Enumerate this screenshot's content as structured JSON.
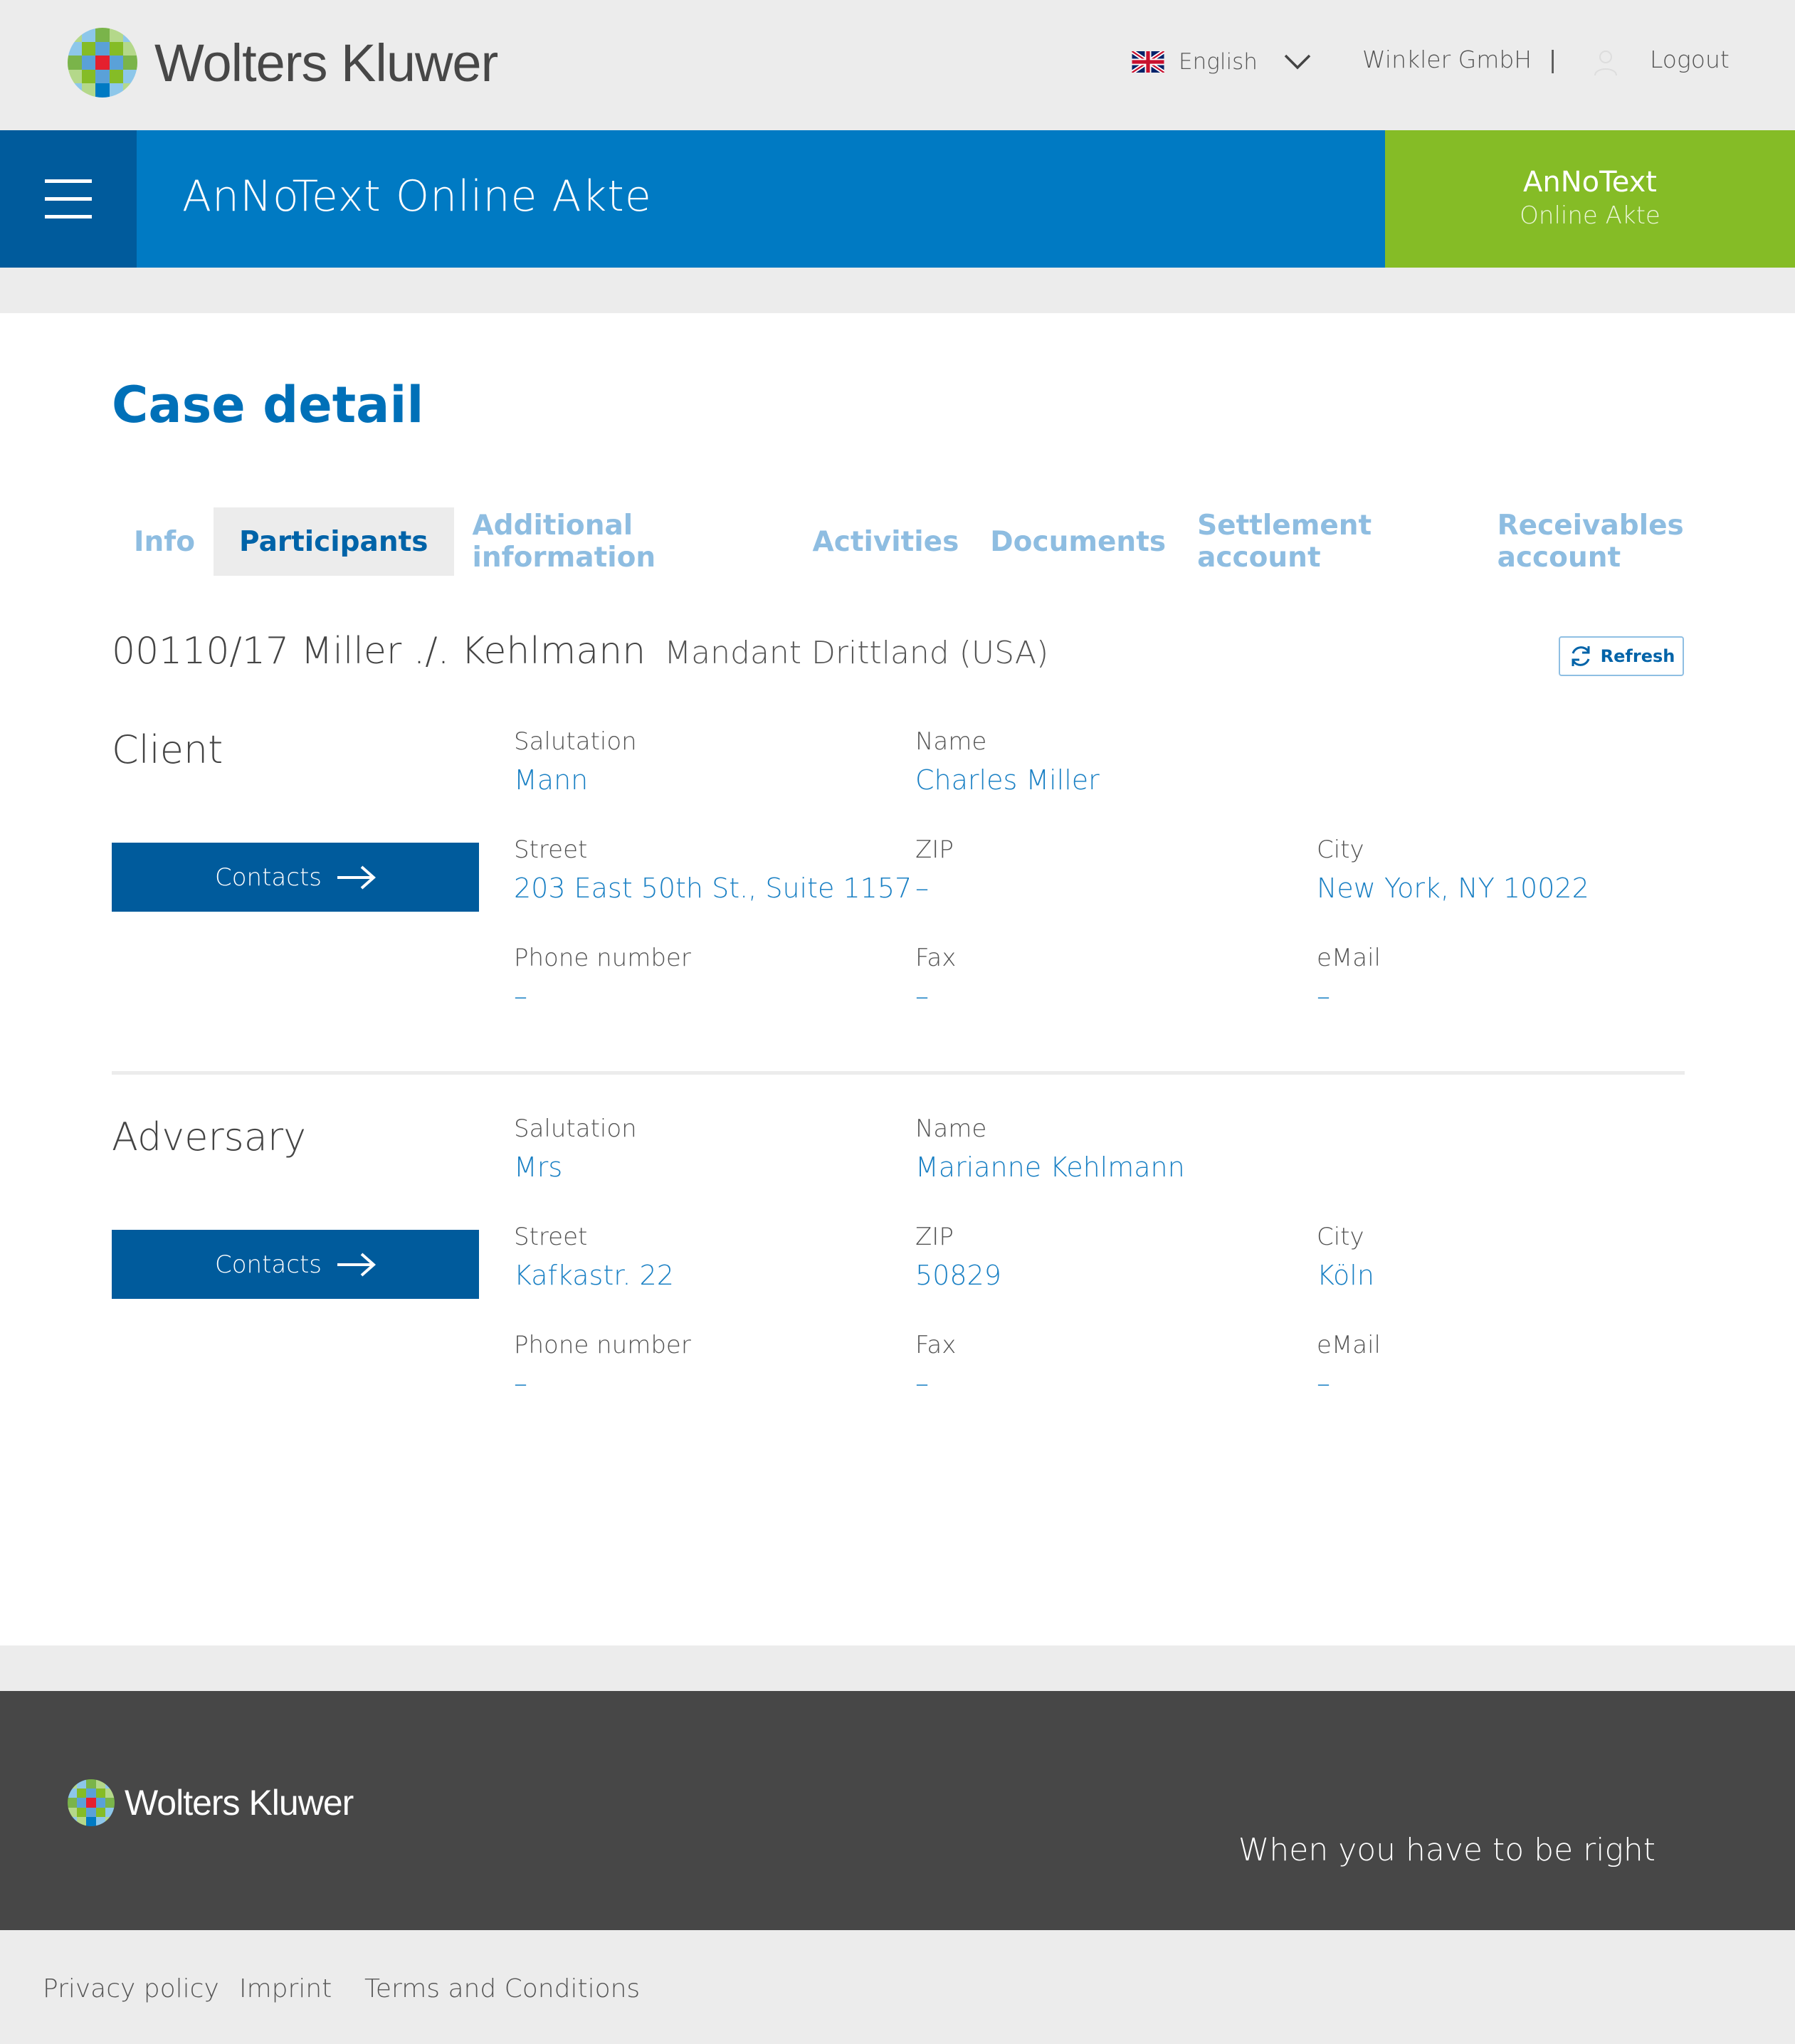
{
  "header": {
    "brand": "Wolters Kluwer",
    "language": "English",
    "company": "Winkler GmbH",
    "separator": "|",
    "logout": "Logout"
  },
  "appbar": {
    "title": "AnNoText Online Akte",
    "brand_line1": "AnNoText",
    "brand_line2": "Online Akte"
  },
  "page": {
    "title": "Case detail",
    "tabs": [
      {
        "label": "Info"
      },
      {
        "label": "Participants"
      },
      {
        "label": "Additional information"
      },
      {
        "label": "Activities"
      },
      {
        "label": "Documents"
      },
      {
        "label": "Settlement account"
      },
      {
        "label": "Receivables account"
      }
    ],
    "active_tab": "Participants",
    "case_id": "00110/17 Miller ./. Kehlmann",
    "case_subtitle": "Mandant Drittland (USA)",
    "refresh_label": "Refresh"
  },
  "client": {
    "title": "Client",
    "contacts_label": "Contacts",
    "salutation_label": "Salutation",
    "salutation": "Mann",
    "name_label": "Name",
    "name": "Charles Miller",
    "street_label": "Street",
    "street": "203 East 50th St., Suite 1157",
    "zip_label": "ZIP",
    "zip": "–",
    "city_label": "City",
    "city": "New York, NY 10022",
    "phone_label": "Phone number",
    "phone": "–",
    "fax_label": "Fax",
    "fax": "–",
    "email_label": "eMail",
    "email": "–"
  },
  "adversary": {
    "title": "Adversary",
    "contacts_label": "Contacts",
    "salutation_label": "Salutation",
    "salutation": "Mrs",
    "name_label": "Name",
    "name": "Marianne Kehlmann",
    "street_label": "Street",
    "street": "Kafkastr. 22",
    "zip_label": "ZIP",
    "zip": "50829",
    "city_label": "City",
    "city": "Köln",
    "phone_label": "Phone number",
    "phone": "–",
    "fax_label": "Fax",
    "fax": "–",
    "email_label": "eMail",
    "email": "–"
  },
  "footer": {
    "brand": "Wolters Kluwer",
    "tagline": "When you have to be right",
    "links": [
      "Privacy policy",
      "Imprint",
      "Terms and Conditions"
    ]
  },
  "colors": {
    "primary_blue": "#007ac3",
    "dark_blue": "#005b9c",
    "green": "#85bc26",
    "footer_dark": "#474747"
  }
}
